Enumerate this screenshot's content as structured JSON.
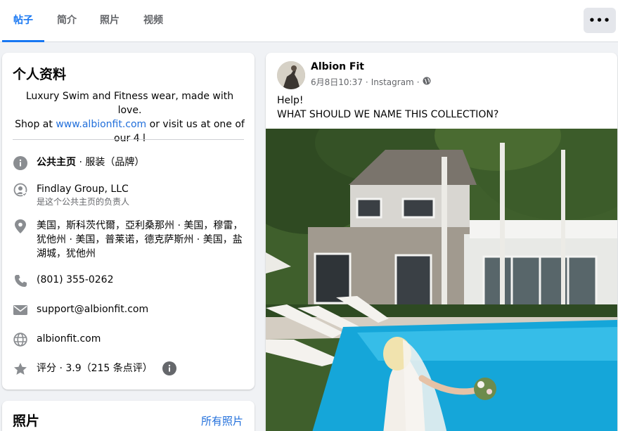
{
  "tabs": [
    {
      "label": "帖子"
    },
    {
      "label": "简介"
    },
    {
      "label": "照片"
    },
    {
      "label": "视频"
    }
  ],
  "more_button": {
    "label": "•••"
  },
  "intro": {
    "title": "个人资料",
    "bio_line1": "Luxury Swim and Fitness wear, made with love.",
    "bio_prefix": "Shop at ",
    "bio_link": "www.albionfit.com",
    "bio_suffix": " or visit us at one of",
    "bio_line3": "our 4 l",
    "category_bold": "公共主页",
    "category_rest": " · 服装（品牌）",
    "owner_name": "Findlay Group, LLC",
    "owner_sub": "是这个公共主页的负责人",
    "address": "美国，斯科茨代爾，亞利桑那州 · 美国，穆雷，犹他州 · 美国，普莱诺，德克萨斯州 · 美国，盐湖城，犹他州",
    "phone": "(801) 355-0262",
    "email": "support@albionfit.com",
    "website": "albionfit.com",
    "rating": "评分 · 3.9（215 条点评）"
  },
  "photos_card": {
    "title": "照片",
    "all_link": "所有照片"
  },
  "post": {
    "author": "Albion Fit",
    "timestamp": "6月8日10:37",
    "source": "Instagram",
    "line1": "Help!",
    "line2": "WHAT SHOULD WE NAME THIS COLLECTION?"
  },
  "colors": {
    "accent": "#1877f2",
    "link": "#216fdb",
    "muted": "#65676b",
    "page_bg": "#f0f2f5"
  }
}
